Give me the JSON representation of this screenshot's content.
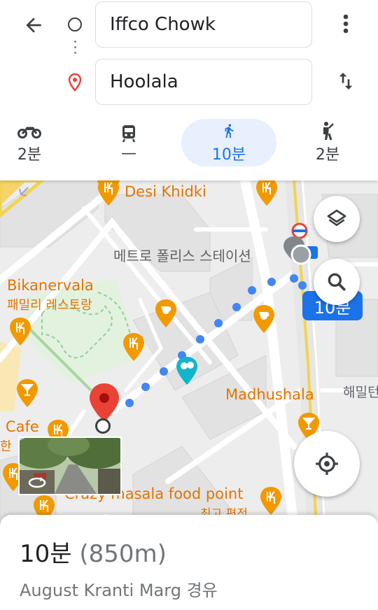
{
  "search": {
    "origin_value": "Iffco Chowk",
    "destination_value": "Hoolala"
  },
  "icons": {
    "back": "arrow-left-icon",
    "origin": "circle-outline-icon",
    "destination": "location-pin-icon",
    "more": "more-vert-icon",
    "swap": "swap-vert-icon",
    "motorcycle": "motorcycle-icon",
    "transit": "train-icon",
    "walk": "walk-icon",
    "ride": "ride-hail-icon",
    "layers": "layers-icon",
    "search": "search-icon",
    "locate": "my-location-icon"
  },
  "modes": [
    {
      "label": "2분",
      "icon": "motorcycle-icon",
      "selected": false
    },
    {
      "label": "—",
      "icon": "train-icon",
      "selected": false
    },
    {
      "label": "10분",
      "icon": "walk-icon",
      "selected": true
    },
    {
      "label": "2분",
      "icon": "ride-hail-icon",
      "selected": false
    }
  ],
  "map": {
    "pois": {
      "desi_khidki": "Desi Khidki",
      "metro_police": "메트로 폴리스 스테이션",
      "bikanervala": "Bikanervala",
      "family_restaurant": "패밀리 레스토랑",
      "madhushala": "Madhushala",
      "haemil": "해밀턴",
      "cafe": "Cafe",
      "han": "한",
      "crazy_masala": "Crazy masala food point",
      "choego": "최고 편전"
    },
    "route_eta": "10분"
  },
  "summary": {
    "duration": "10분",
    "distance": "(850m)",
    "via": "August Kranti Marg 경유"
  },
  "colors": {
    "accent": "#1a73e8",
    "poi_orange": "#e37400",
    "pin_red": "#ea4335",
    "highway_yellow": "#f2d44e"
  }
}
